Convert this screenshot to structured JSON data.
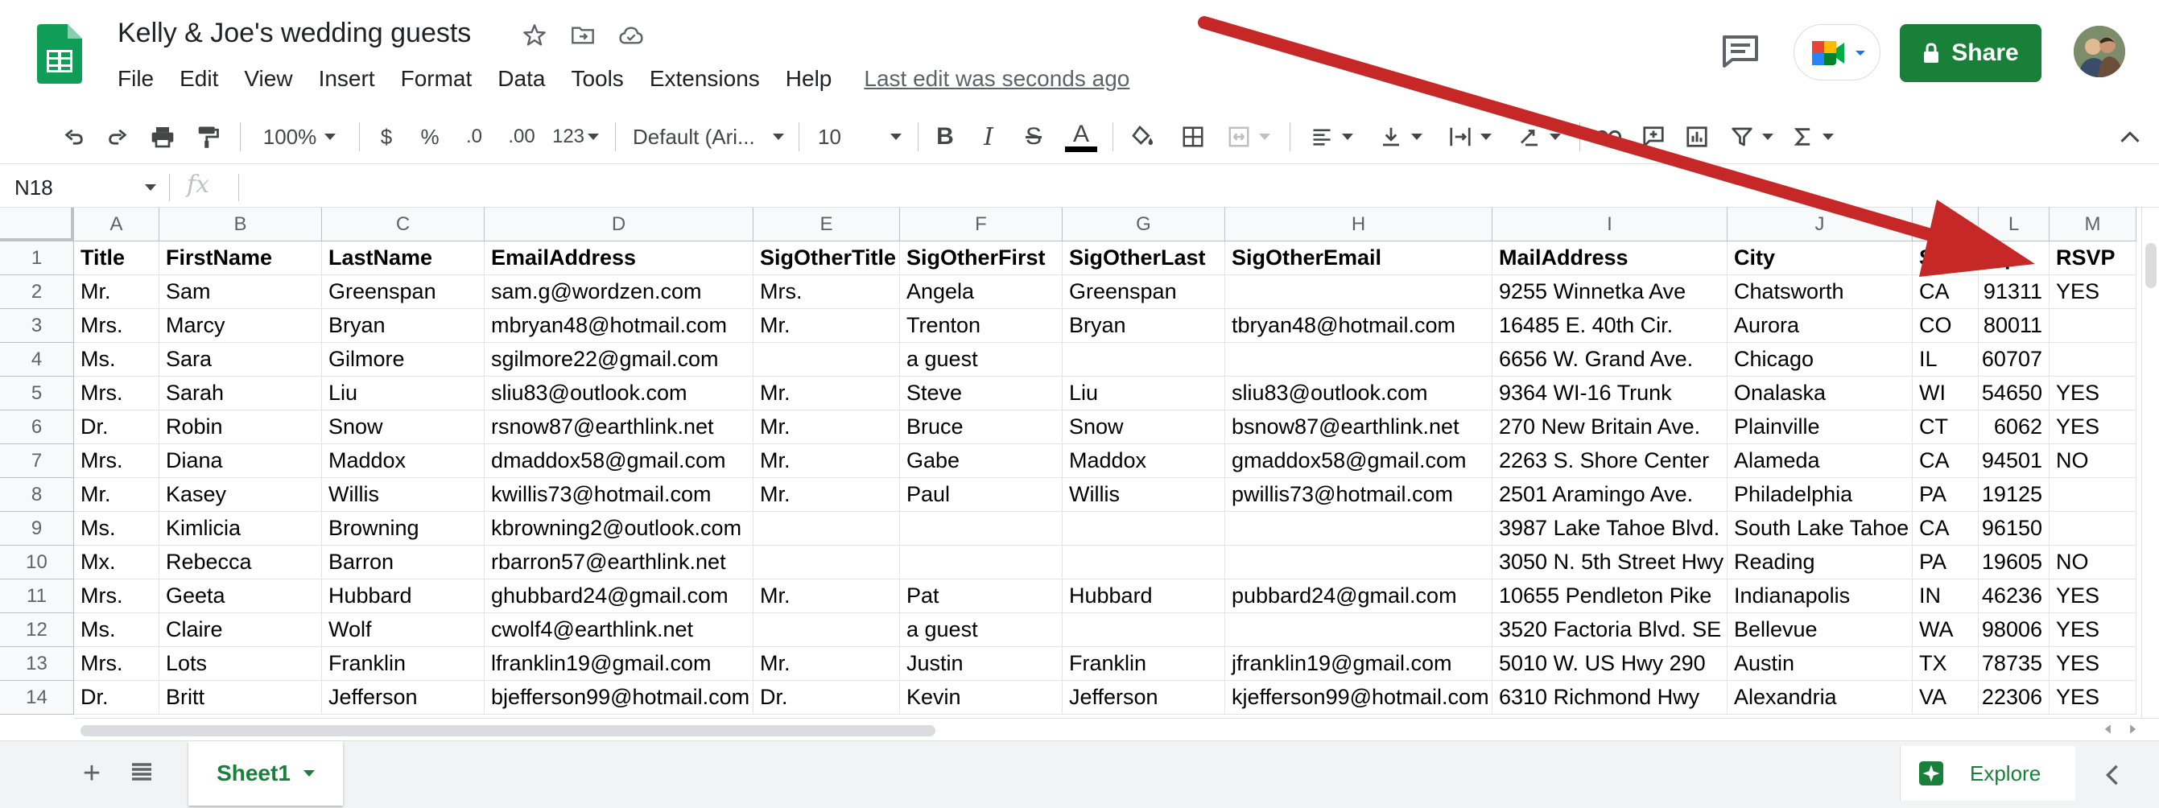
{
  "app": {
    "doc_title": "Kelly & Joe's wedding guests",
    "menu": [
      "File",
      "Edit",
      "View",
      "Insert",
      "Format",
      "Data",
      "Tools",
      "Extensions",
      "Help"
    ],
    "last_edit": "Last edit was seconds ago",
    "share_label": "Share",
    "accent": "#188038"
  },
  "toolbar": {
    "zoom": "100%",
    "currency": "$",
    "percent": "%",
    "decrease_decimal": ".0",
    "increase_decimal": ".00",
    "more_formats": "123",
    "font_family": "Default (Ari...",
    "font_size": "10",
    "bold": "B",
    "italic": "I",
    "strike": "S",
    "text_color": "A"
  },
  "formula_bar": {
    "cell_ref": "N18",
    "fx": "fx"
  },
  "grid": {
    "columns": [
      "A",
      "B",
      "C",
      "D",
      "E",
      "F",
      "G",
      "H",
      "I",
      "J",
      "K",
      "L",
      "M"
    ],
    "row_numbers": [
      "1",
      "2",
      "3",
      "4",
      "5",
      "6",
      "7",
      "8",
      "9",
      "10",
      "11",
      "12",
      "13",
      "14"
    ],
    "rows": [
      [
        "Title",
        "FirstName",
        "LastName",
        "EmailAddress",
        "SigOtherTitle",
        "SigOtherFirst",
        "SigOtherLast",
        "SigOtherEmail",
        "MailAddress",
        "City",
        "State",
        "Zip",
        "RSVP"
      ],
      [
        "Mr.",
        "Sam",
        "Greenspan",
        "sam.g@wordzen.com",
        "Mrs.",
        "Angela",
        "Greenspan",
        "",
        "9255 Winnetka Ave",
        "Chatsworth",
        "CA",
        "91311",
        "YES"
      ],
      [
        "Mrs.",
        "Marcy",
        "Bryan",
        "mbryan48@hotmail.com",
        "Mr.",
        "Trenton",
        "Bryan",
        "tbryan48@hotmail.com",
        "16485 E. 40th Cir.",
        "Aurora",
        "CO",
        "80011",
        ""
      ],
      [
        "Ms.",
        "Sara",
        "Gilmore",
        "sgilmore22@gmail.com",
        "",
        "a guest",
        "",
        "",
        "6656 W. Grand Ave.",
        "Chicago",
        "IL",
        "60707",
        ""
      ],
      [
        "Mrs.",
        "Sarah",
        "Liu",
        "sliu83@outlook.com",
        "Mr.",
        "Steve",
        "Liu",
        "sliu83@outlook.com",
        "9364 WI-16 Trunk",
        "Onalaska",
        "WI",
        "54650",
        "YES"
      ],
      [
        "Dr.",
        "Robin",
        "Snow",
        "rsnow87@earthlink.net",
        "Mr.",
        "Bruce",
        "Snow",
        "bsnow87@earthlink.net",
        "270 New Britain Ave.",
        "Plainville",
        "CT",
        "6062",
        "YES"
      ],
      [
        "Mrs.",
        "Diana",
        "Maddox",
        "dmaddox58@gmail.com",
        "Mr.",
        "Gabe",
        "Maddox",
        "gmaddox58@gmail.com",
        "2263 S. Shore Center",
        "Alameda",
        "CA",
        "94501",
        "NO"
      ],
      [
        "Mr.",
        "Kasey",
        "Willis",
        "kwillis73@hotmail.com",
        "Mr.",
        "Paul",
        "Willis",
        "pwillis73@hotmail.com",
        "2501 Aramingo Ave.",
        "Philadelphia",
        "PA",
        "19125",
        ""
      ],
      [
        "Ms.",
        "Kimlicia",
        "Browning",
        "kbrowning2@outlook.com",
        "",
        "",
        "",
        "",
        "3987 Lake Tahoe Blvd.",
        "South Lake Tahoe",
        "CA",
        "96150",
        ""
      ],
      [
        "Mx.",
        "Rebecca",
        "Barron",
        "rbarron57@earthlink.net",
        "",
        "",
        "",
        "",
        "3050 N. 5th Street Hwy",
        "Reading",
        "PA",
        "19605",
        "NO"
      ],
      [
        "Mrs.",
        "Geeta",
        "Hubbard",
        "ghubbard24@gmail.com",
        "Mr.",
        "Pat",
        "Hubbard",
        "pubbard24@gmail.com",
        "10655 Pendleton Pike",
        "Indianapolis",
        "IN",
        "46236",
        "YES"
      ],
      [
        "Ms.",
        "Claire",
        "Wolf",
        "cwolf4@earthlink.net",
        "",
        "a guest",
        "",
        "",
        "3520 Factoria Blvd. SE",
        "Bellevue",
        "WA",
        "98006",
        "YES"
      ],
      [
        "Mrs.",
        "Lots",
        "Franklin",
        "lfranklin19@gmail.com",
        "Mr.",
        "Justin",
        "Franklin",
        "jfranklin19@gmail.com",
        "5010 W. US Hwy 290",
        "Austin",
        "TX",
        "78735",
        "YES"
      ],
      [
        "Dr.",
        "Britt",
        "Jefferson",
        "bjefferson99@hotmail.com",
        "Dr.",
        "Kevin",
        "Jefferson",
        "kjefferson99@hotmail.com",
        "6310 Richmond Hwy",
        "Alexandria",
        "VA",
        "22306",
        "YES"
      ]
    ]
  },
  "sheets": {
    "active": "Sheet1",
    "explore_label": "Explore"
  },
  "annotation": {
    "arrow_color": "#c62828"
  }
}
